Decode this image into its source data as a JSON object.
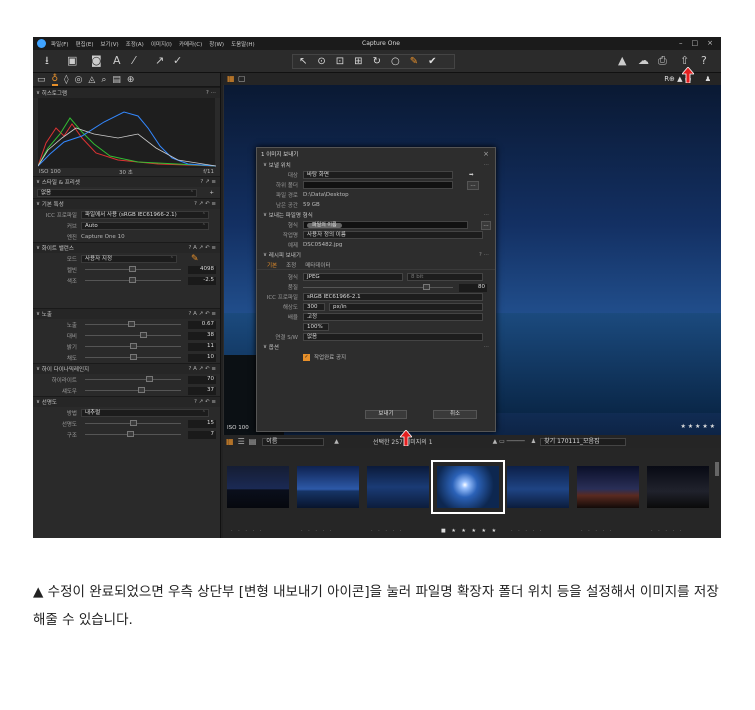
{
  "app": {
    "title": "Capture One",
    "menu": [
      "파일(F)",
      "편집(E)",
      "보기(V)",
      "조정(A)",
      "이미지(I)",
      "카메라(C)",
      "창(W)",
      "도움말(H)"
    ],
    "win_buttons": [
      "–",
      "□",
      "×"
    ]
  },
  "toolbar": {
    "left_icons": [
      "import-icon",
      "export-icon",
      "camera-icon",
      "text-icon",
      "brush-icon",
      "arrow-icon",
      "check-icon"
    ],
    "cursor_tools": [
      "↖",
      "⊙",
      "⊡",
      "⊞",
      "↻",
      "○",
      "✎",
      "✔"
    ],
    "right_glyphs": [
      "▲",
      "☁",
      "⎙",
      "⇧",
      "?"
    ]
  },
  "left_panel": {
    "histogram": {
      "title": "히스토그램",
      "iso": "ISO 100",
      "shutter": "30 초",
      "aperture": "f/11",
      "icons": "? ⋯"
    },
    "styles": {
      "title": "스타일 & 프리셋",
      "value": "없음"
    },
    "base": {
      "title": "기본 특성",
      "icc_label": "ICC 프로파일",
      "icc_value": "파일에서 사용 (sRGB IEC61966-2.1)",
      "curve_label": "커브",
      "curve_value": "Auto",
      "engine_label": "엔진",
      "engine_value": "Capture One 10"
    },
    "wb": {
      "title": "화이트 밸런스",
      "mode_label": "모드",
      "mode_value": "사용자 지정",
      "kelvin_label": "켈빈",
      "kelvin_value": "4098",
      "tint_label": "색조",
      "tint_value": "-2.5"
    },
    "exposure": {
      "title": "노출",
      "rows": [
        {
          "label": "노출",
          "value": "0.67",
          "pos": 0.48
        },
        {
          "label": "대비",
          "value": "38",
          "pos": 0.62
        },
        {
          "label": "밝기",
          "value": "11",
          "pos": 0.5
        },
        {
          "label": "채도",
          "value": "10",
          "pos": 0.5
        }
      ]
    },
    "hdr": {
      "title": "하이 다이나믹레인지",
      "rows": [
        {
          "label": "하이라이트",
          "value": "70",
          "pos": 0.68
        },
        {
          "label": "섀도우",
          "value": "37",
          "pos": 0.6
        }
      ]
    },
    "clarity": {
      "title": "선명도",
      "method_label": "방법",
      "method_value": "내추럴",
      "rows": [
        {
          "label": "선명도",
          "value": "15",
          "pos": 0.5
        },
        {
          "label": "구조",
          "value": "7",
          "pos": 0.47
        }
      ]
    }
  },
  "dialog": {
    "title": "1 이미지 보내기",
    "dest_section": "보낼 위치",
    "target_label": "대상",
    "target_value": "바탕 화면",
    "subfolder_label": "하위 폴더",
    "path_label": "파일 경로",
    "path_value": "D:\\Data\\Desktop",
    "free_label": "남은 공간",
    "free_value": "59 GB",
    "name_section": "보내는 파일명 형식",
    "format_label": "형식",
    "format_token": "파일의 이름",
    "jobname_label": "작업명",
    "jobname_value": "사용자 정의 이름",
    "sample_label": "예제",
    "sample_value": "DSC05482.jpg",
    "recipe_section": "레시피 보내기",
    "tabs": [
      "기본",
      "조정",
      "메타데이터"
    ],
    "fmt_label": "형식",
    "fmt_value": "JPEG",
    "bit_value": "8 bit",
    "quality_label": "품질",
    "quality_value": "80",
    "icc_label": "ICC 프로파일",
    "icc_value": "sRGB IEC61966-2.1",
    "res_label": "해상도",
    "res_value": "300",
    "res_unit": "px/in",
    "scale_label": "배율",
    "scale_value": "고정",
    "scale_pct": "100%",
    "open_label": "연결 S/W",
    "open_value": "없음",
    "options_section": "옵션",
    "notify_label": "작업완료 공지",
    "export_button": "보내기",
    "cancel_button": "취소"
  },
  "viewer": {
    "iso": "ISO 100",
    "stars": "★ ★ ★ ★ ★"
  },
  "filmstrip": {
    "sort": "이름",
    "count": "선택한 257 이미지의 1",
    "search": "찾기 170111_모음집"
  },
  "caption": "▲ 수정이 완료되었으면 우측 상단부 [변형 내보내기 아이콘]을 눌러 파일명 확장자 폴더 위치 등을 설정해서 이미지를 저장해줄 수 있습니다.",
  "colors": {
    "accent": "#e8902a",
    "highlight_arrow": "#e41f1f",
    "selected_thumb": "#ffffff"
  }
}
